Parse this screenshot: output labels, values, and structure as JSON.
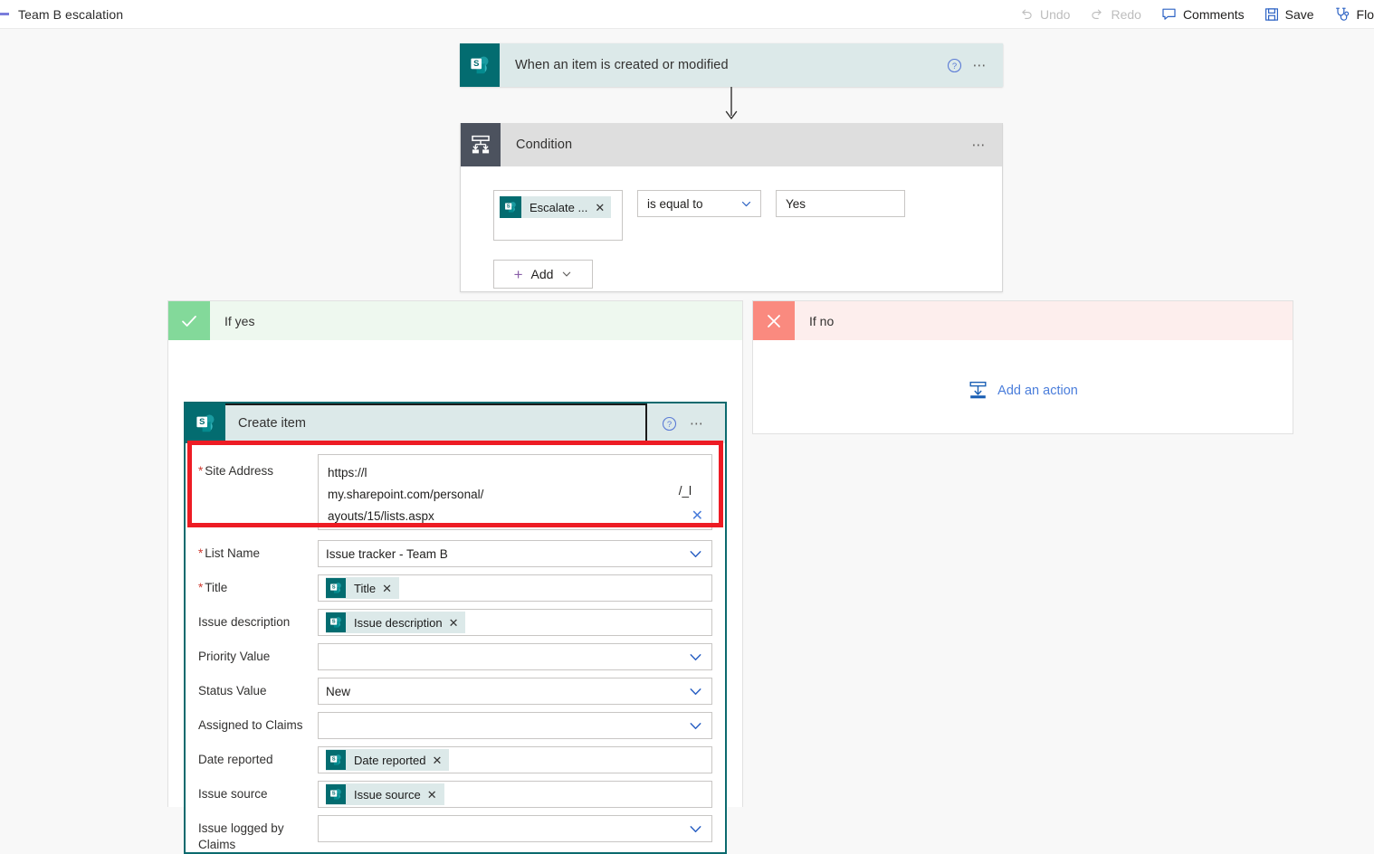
{
  "topbar": {
    "flow_title": "Team B escalation",
    "commands": [
      {
        "id": "undo",
        "label": "Undo",
        "icon": "undo-icon",
        "disabled": true
      },
      {
        "id": "redo",
        "label": "Redo",
        "icon": "redo-icon",
        "disabled": true
      },
      {
        "id": "comments",
        "label": "Comments",
        "icon": "comment-icon",
        "disabled": false
      },
      {
        "id": "save",
        "label": "Save",
        "icon": "save-icon",
        "disabled": false
      },
      {
        "id": "flow_checker",
        "label": "Flo",
        "icon": "stethoscope-icon",
        "disabled": false
      }
    ]
  },
  "trigger": {
    "title": "When an item is created or modified",
    "icon": "sharepoint-icon",
    "help_icon": "help-icon",
    "menu_icon": "ellipsis-icon"
  },
  "condition": {
    "title": "Condition",
    "icon": "condition-icon",
    "menu_icon": "ellipsis-icon",
    "operand_token": "Escalate ...",
    "operator": "is equal to",
    "value": "Yes",
    "add_label": "Add"
  },
  "branches": {
    "yes": {
      "label": "If yes",
      "badge": "check-icon"
    },
    "no": {
      "label": "If no",
      "badge": "cross-icon",
      "add_action_label": "Add an action",
      "add_action_icon": "add-action-icon"
    }
  },
  "create_item": {
    "title": "Create item",
    "icon": "sharepoint-icon",
    "help_icon": "help-icon",
    "menu_icon": "ellipsis-icon",
    "site_address": {
      "label": "Site Address",
      "required": true,
      "line1": "https://l",
      "line2": "my.sharepoint.com/personal/",
      "line2_tail": "/_l",
      "line3": "ayouts/15/lists.aspx",
      "clear_icon": "clear-icon"
    },
    "fields": [
      {
        "label": "List Name",
        "required": true,
        "type": "dropdown",
        "value": "Issue tracker - Team B"
      },
      {
        "label": "Title",
        "required": true,
        "type": "token",
        "value": "Title"
      },
      {
        "label": "Issue description",
        "required": false,
        "type": "token",
        "value": "Issue description"
      },
      {
        "label": "Priority Value",
        "required": false,
        "type": "dropdown",
        "value": ""
      },
      {
        "label": "Status Value",
        "required": false,
        "type": "dropdown",
        "value": "New"
      },
      {
        "label": "Assigned to Claims",
        "required": false,
        "type": "dropdown",
        "value": ""
      },
      {
        "label": "Date reported",
        "required": false,
        "type": "token",
        "value": "Date reported"
      },
      {
        "label": "Issue source",
        "required": false,
        "type": "token",
        "value": "Issue source"
      },
      {
        "label": "Issue logged by Claims",
        "required": false,
        "type": "dropdown",
        "value": ""
      }
    ]
  },
  "annotation": {
    "shape": "rectangle",
    "color": "#ed1c24",
    "target": "site-address-field"
  },
  "colors": {
    "sharepoint_teal": "#036c70",
    "sharepoint_header": "#dce9e9",
    "condition_icon": "#4c525e",
    "condition_header": "#dedede",
    "yes_badge": "#83d99a",
    "no_badge": "#fa8a7f",
    "accent_link": "#4a7ddb",
    "annotation_red": "#ed1c24"
  }
}
